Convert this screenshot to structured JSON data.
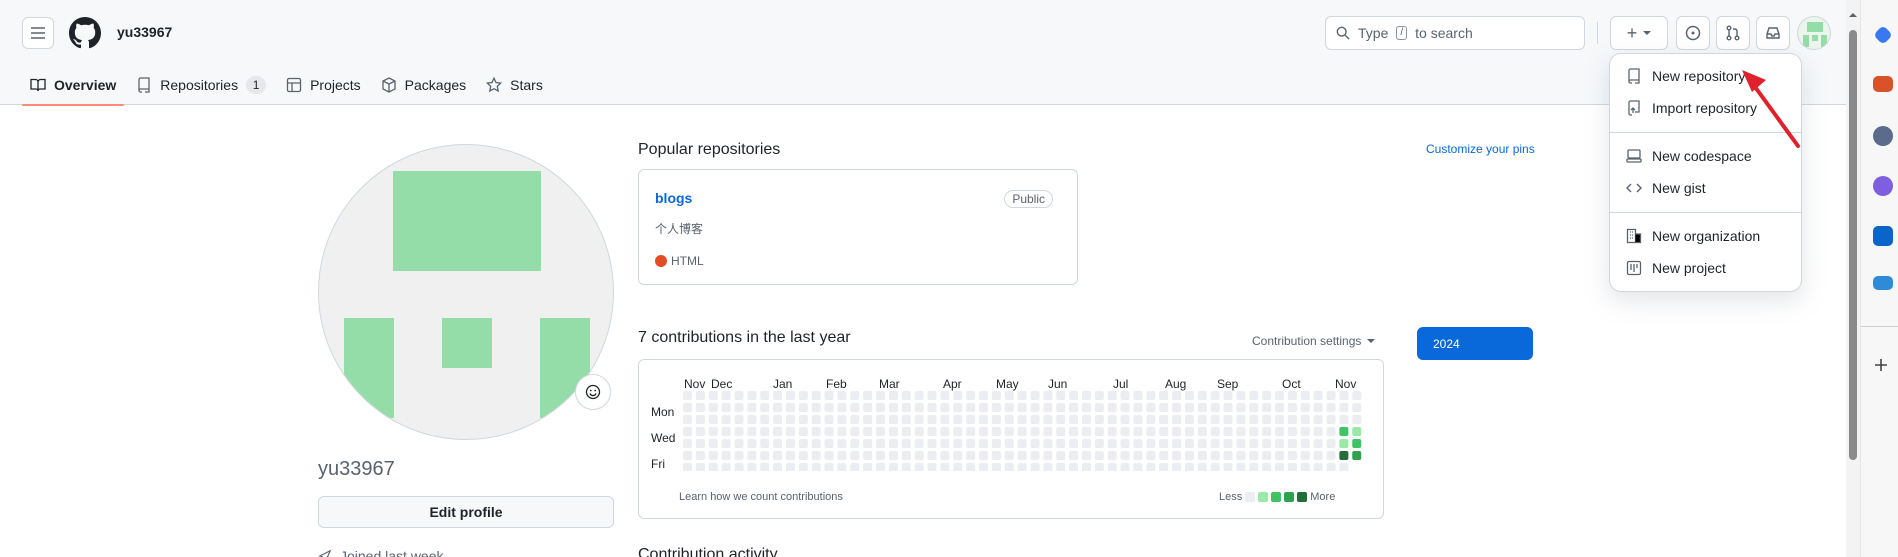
{
  "header": {
    "username": "yu33967",
    "search_prefix": "Type",
    "search_key": "/",
    "search_suffix": "to search",
    "plus_label": "+"
  },
  "tabs": [
    {
      "label": "Overview",
      "icon": "book-icon"
    },
    {
      "label": "Repositories",
      "count": "1",
      "icon": "repo-icon"
    },
    {
      "label": "Projects",
      "icon": "table-icon"
    },
    {
      "label": "Packages",
      "icon": "package-icon"
    },
    {
      "label": "Stars",
      "icon": "star-icon"
    }
  ],
  "profile": {
    "name": "yu33967",
    "edit_label": "Edit profile",
    "joined_text": "Joined last week"
  },
  "popular": {
    "title": "Popular repositories",
    "customize_label": "Customize your pins",
    "repo": {
      "name": "blogs",
      "visibility": "Public",
      "description": "个人博客",
      "language": "HTML",
      "language_color": "#e34c26"
    }
  },
  "contributions": {
    "title": "7 contributions in the last year",
    "settings_label": "Contribution settings",
    "year": "2024",
    "months": [
      "Nov",
      "Dec",
      "Jan",
      "Feb",
      "Mar",
      "Apr",
      "May",
      "Jun",
      "Jul",
      "Aug",
      "Sep",
      "Oct",
      "Nov"
    ],
    "days": [
      "Mon",
      "Wed",
      "Fri"
    ],
    "learn_label": "Learn how we count contributions",
    "less_label": "Less",
    "more_label": "More",
    "levels": [
      "#ebedf0",
      "#9be9a8",
      "#40c463",
      "#30a14e",
      "#216e39"
    ]
  },
  "activity": {
    "title": "Contribution activity"
  },
  "dropdown": {
    "items": [
      {
        "label": "New repository",
        "icon": "repo-icon"
      },
      {
        "label": "Import repository",
        "icon": "repo-push-icon"
      },
      {
        "label": "New codespace",
        "icon": "codespace-icon"
      },
      {
        "label": "New gist",
        "icon": "code-icon"
      },
      {
        "label": "New organization",
        "icon": "organization-icon"
      },
      {
        "label": "New project",
        "icon": "project-icon"
      }
    ]
  },
  "colors": {
    "accent": "#0969da",
    "tab_underline": "#fd8c73",
    "avatar_green": "#94dca8",
    "arrow_red": "#e0202a"
  }
}
